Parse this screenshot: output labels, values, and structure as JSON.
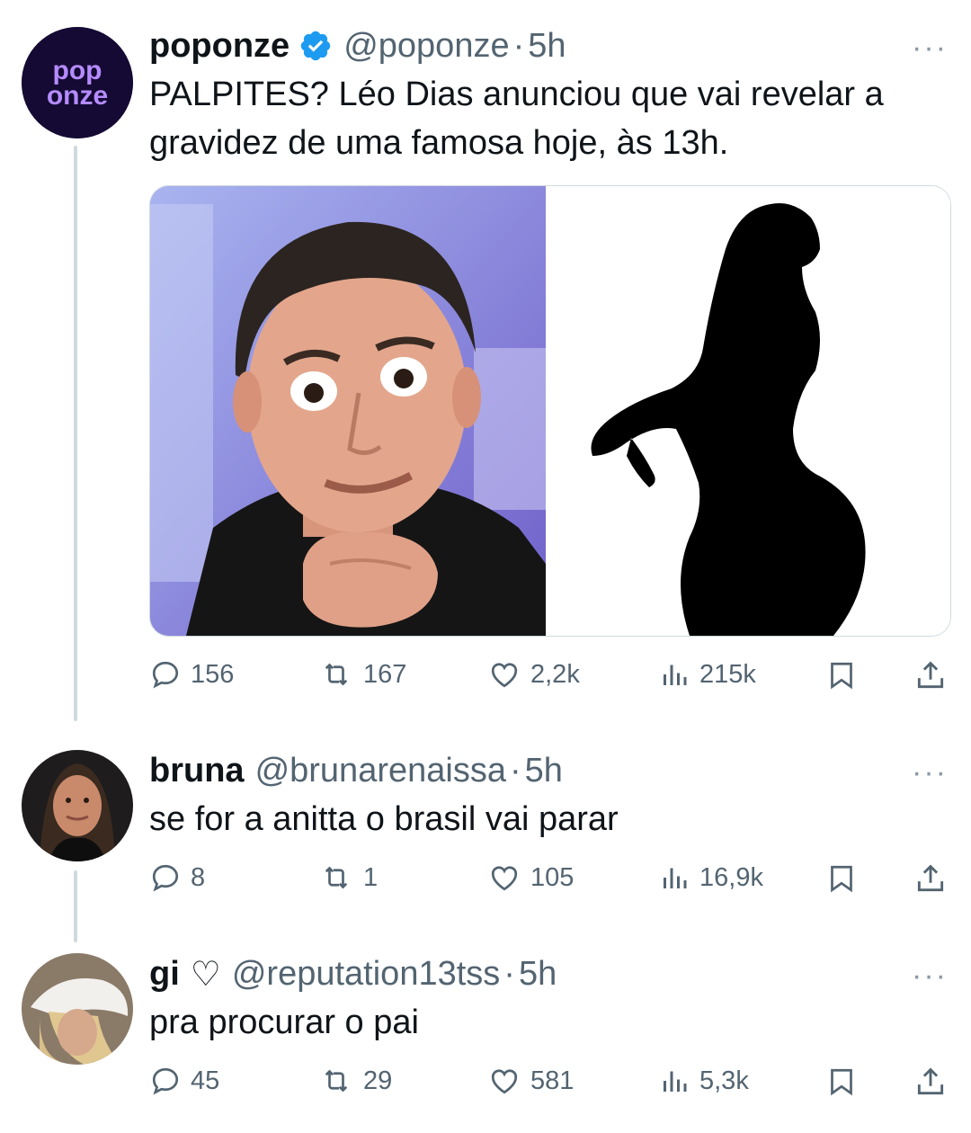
{
  "tweets": [
    {
      "name": "poponze",
      "handle": "@poponze",
      "dot": "·",
      "time": "5h",
      "verified": true,
      "avatar_text_line1": "pop",
      "avatar_text_line2": "onze",
      "text_line1": "PALPITES? Léo Dias anunciou que vai revelar a",
      "text_line2": "gravidez de uma famosa hoje, às 13h.",
      "stats": {
        "replies": "156",
        "reposts": "167",
        "likes": "2,2k",
        "views": "215k"
      }
    },
    {
      "name": "bruna",
      "handle": "@brunarenaissa",
      "dot": "·",
      "time": "5h",
      "text_line1": "se for a anitta o brasil vai parar",
      "stats": {
        "replies": "8",
        "reposts": "1",
        "likes": "105",
        "views": "16,9k"
      }
    },
    {
      "name": "gi",
      "name_suffix": "♡",
      "handle": "@reputation13tss",
      "dot": "·",
      "time": "5h",
      "text_line1": "pra procurar o pai",
      "stats": {
        "replies": "45",
        "reposts": "29",
        "likes": "581",
        "views": "5,3k"
      }
    }
  ],
  "more_label": "···",
  "icons": [
    "verified-badge-icon",
    "reply-icon",
    "repost-icon",
    "like-icon",
    "views-icon",
    "bookmark-icon",
    "share-icon",
    "more-icon"
  ],
  "colors": {
    "verified": "#1d9bf0",
    "muted": "#536471",
    "thread": "#cfd9de",
    "brand_purple": "#7b3ff2"
  }
}
